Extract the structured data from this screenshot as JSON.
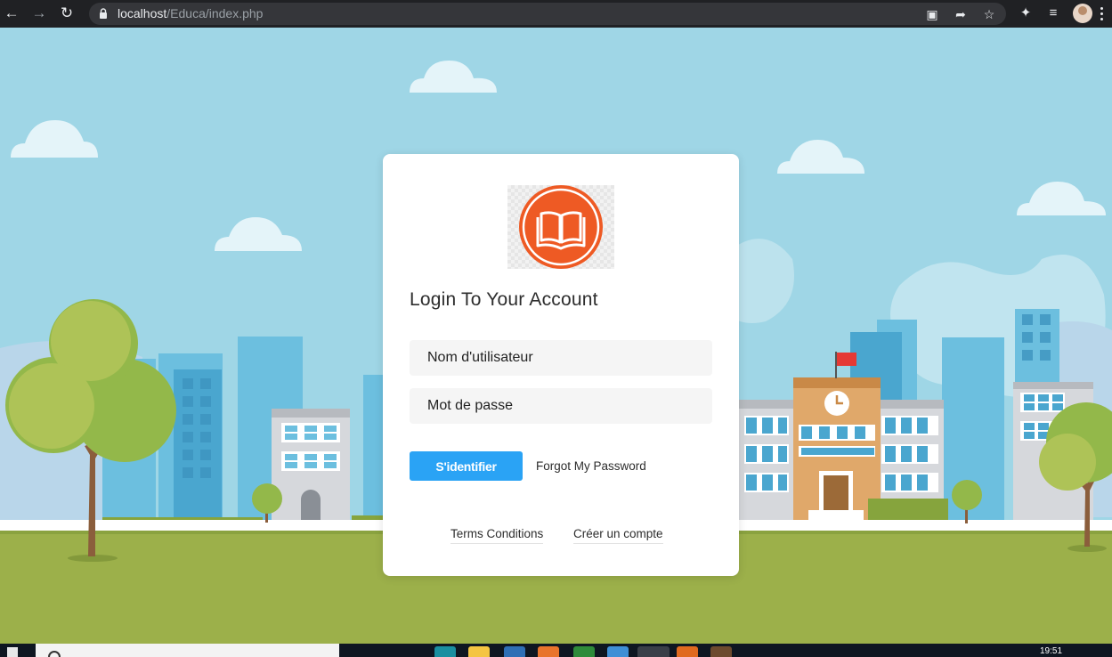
{
  "browser": {
    "url_host": "localhost",
    "url_path": "/Educa/index.php"
  },
  "login": {
    "title": "Login To Your Account",
    "username_placeholder": "Nom d'utilisateur",
    "password_placeholder": "Mot de passe",
    "submit_label": "S'identifier",
    "forgot_label": "Forgot My Password",
    "terms_label": "Terms Conditions",
    "create_account_label": "Créer un compte"
  },
  "taskbar": {
    "clock": "19:51"
  },
  "colors": {
    "accent": "#2aa3f5",
    "logo": "#ee5a24",
    "sky": "#9fd6e6",
    "grass": "#9cb04a"
  }
}
